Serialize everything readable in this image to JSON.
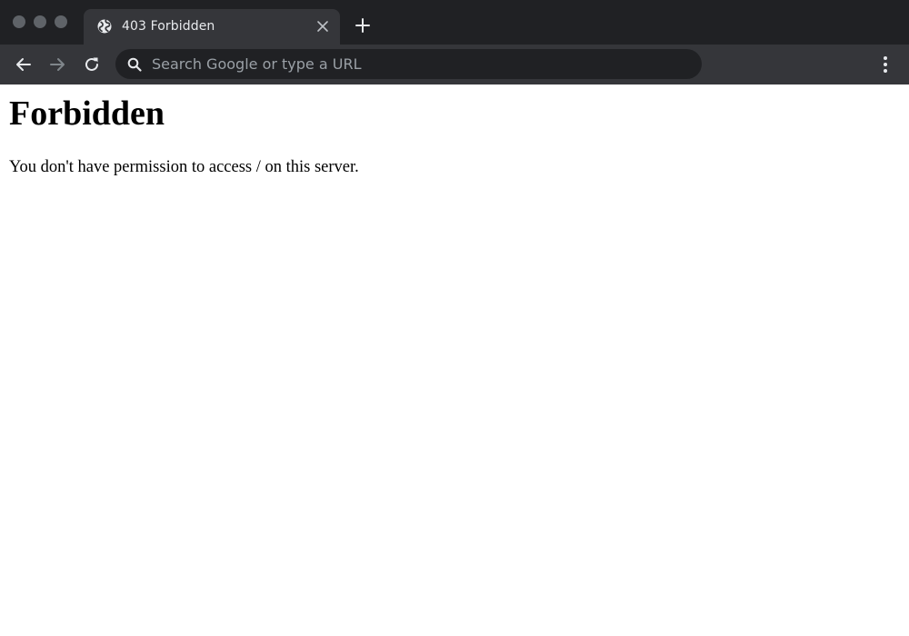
{
  "browser": {
    "tab": {
      "title": "403 Forbidden",
      "favicon": "globe-icon"
    },
    "omnibox": {
      "placeholder": "Search Google or type a URL",
      "value": ""
    },
    "toolbar": {
      "back_icon": "arrow-left-icon",
      "forward_icon": "arrow-right-icon",
      "reload_icon": "reload-icon",
      "menu_icon": "kebab-menu-icon"
    },
    "colors": {
      "titlebar": "#202124",
      "toolbar": "#35363a",
      "tab_active": "#35363a",
      "omnibox": "#202124",
      "text_light": "#e8eaed",
      "placeholder": "#9aa0a6"
    }
  },
  "page": {
    "heading": "Forbidden",
    "message": "You don't have permission to access / on this server."
  }
}
